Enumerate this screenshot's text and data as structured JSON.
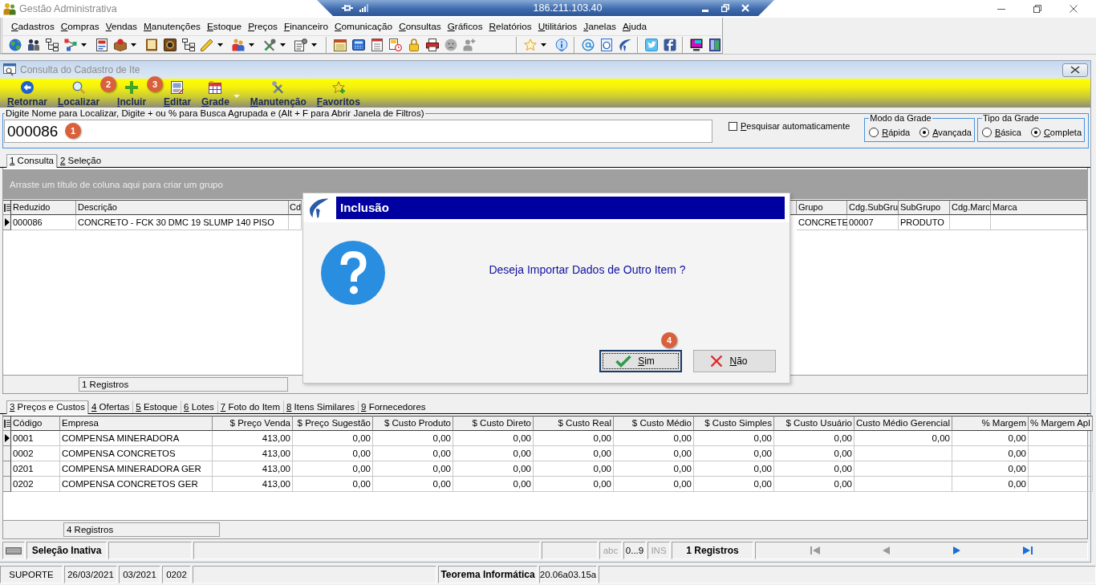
{
  "window": {
    "title": "Gestão Administrativa"
  },
  "remote_bar": {
    "address": "186.211.103.40"
  },
  "menu": [
    "Cadastros",
    "Compras",
    "Vendas",
    "Manutenções",
    "Estoque",
    "Preços",
    "Financeiro",
    "Comunicação",
    "Consultas",
    "Gráficos",
    "Relatórios",
    "Utilitários",
    "Janelas",
    "Ajuda"
  ],
  "child_window": {
    "title": "Consulta do Cadastro de Ite"
  },
  "toolbar": [
    {
      "label": "Retornar",
      "dropdown": false
    },
    {
      "label": "Localizar",
      "dropdown": false,
      "marker": "2"
    },
    {
      "label": "Incluir",
      "dropdown": false,
      "marker": "3"
    },
    {
      "label": "Editar",
      "dropdown": false
    },
    {
      "label": "Grade",
      "dropdown": true
    },
    {
      "label": "Manutenção",
      "dropdown": false
    },
    {
      "label": "Favoritos",
      "dropdown": false
    }
  ],
  "search": {
    "legend": "Digite Nome para Localizar, Digite + ou % para Busca Agrupada e (Alt + F para Abrir Janela de Filtros)",
    "value": "000086",
    "marker": "1",
    "auto_search": {
      "label": "Pesquisar automaticamente",
      "checked": false
    }
  },
  "grid_mode": {
    "title": "Modo da Grade",
    "options": [
      {
        "label": "Rápida",
        "selected": false
      },
      {
        "label": "Avançada",
        "selected": true
      }
    ]
  },
  "grid_type": {
    "title": "Tipo da Grade",
    "options": [
      {
        "label": "Básica",
        "selected": false
      },
      {
        "label": "Completa",
        "selected": true
      }
    ]
  },
  "tabs": [
    {
      "label": "1 Consulta",
      "selected": true
    },
    {
      "label": "2 Seleção",
      "selected": false
    }
  ],
  "items_table": {
    "group_hint": "Arraste um título de coluna aqui para criar um grupo",
    "columns": [
      "Reduzido",
      "Descrição",
      "Cd",
      "Grupo",
      "Cdg.SubGru",
      "SubGrupo",
      "Cdg.Marc",
      "Marca"
    ],
    "rows": [
      {
        "selected": true,
        "cells": [
          "000086",
          "CONCRETO - FCK 30 DMC 19 SLUMP 140 PISO",
          null,
          "CONCRETE",
          "00007",
          "PRODUTO",
          null,
          null
        ]
      }
    ],
    "footer": "1 Registros"
  },
  "detail_tabs": [
    {
      "label": "3 Preços e Custos",
      "selected": true
    },
    {
      "label": "4 Ofertas",
      "selected": false
    },
    {
      "label": "5 Estoque",
      "selected": false
    },
    {
      "label": "6 Lotes",
      "selected": false
    },
    {
      "label": "7 Foto do Item",
      "selected": false
    },
    {
      "label": "8 Itens Similares",
      "selected": false
    },
    {
      "label": "9 Fornecedores",
      "selected": false
    }
  ],
  "prices_table": {
    "columns": [
      {
        "label": "Código",
        "kind": "text"
      },
      {
        "label": "Empresa",
        "kind": "text"
      },
      {
        "label": "$ Preço Venda",
        "kind": "number"
      },
      {
        "label": "$ Preço Sugestão",
        "kind": "number"
      },
      {
        "label": "$ Custo Produto",
        "kind": "number"
      },
      {
        "label": "$ Custo Direto",
        "kind": "number"
      },
      {
        "label": "$ Custo Real",
        "kind": "number"
      },
      {
        "label": "$ Custo Médio",
        "kind": "number"
      },
      {
        "label": "$ Custo Simples",
        "kind": "number"
      },
      {
        "label": "$ Custo Usuário",
        "kind": "number"
      },
      {
        "label": "Custo Médio Gerencial",
        "kind": "number"
      },
      {
        "label": "% Margem",
        "kind": "number"
      },
      {
        "label": "% Margem Apl",
        "kind": "number"
      }
    ],
    "rows": [
      {
        "selected": true,
        "cells": [
          "0001",
          "COMPENSA MINERADORA",
          "413,00",
          "0,00",
          "0,00",
          "0,00",
          "0,00",
          "0,00",
          "0,00",
          "0,00",
          "0,00",
          "0,00",
          null
        ]
      },
      {
        "selected": false,
        "cells": [
          "0002",
          "COMPENSA CONCRETOS",
          "413,00",
          "0,00",
          "0,00",
          "0,00",
          "0,00",
          "0,00",
          "0,00",
          "0,00",
          null,
          "0,00",
          null
        ]
      },
      {
        "selected": false,
        "cells": [
          "0201",
          "COMPENSA MINERADORA GER",
          "413,00",
          "0,00",
          "0,00",
          "0,00",
          "0,00",
          "0,00",
          "0,00",
          "0,00",
          null,
          "0,00",
          null
        ]
      },
      {
        "selected": false,
        "cells": [
          "0202",
          "COMPENSA CONCRETOS GER",
          "413,00",
          "0,00",
          "0,00",
          "0,00",
          "0,00",
          "0,00",
          "0,00",
          "0,00",
          null,
          "0,00",
          null
        ]
      }
    ],
    "footer": "4 Registros"
  },
  "status_bar": {
    "selection": "Seleção Inativa",
    "indicators": [
      {
        "label": "abc",
        "on": false
      },
      {
        "label": "0...9",
        "on": true
      },
      {
        "label": "INS",
        "on": false
      }
    ],
    "records": "1 Registros",
    "navigation": [
      {
        "kind": "first",
        "disabled": true
      },
      {
        "kind": "previous",
        "disabled": true
      },
      {
        "kind": "next",
        "disabled": false
      },
      {
        "kind": "last",
        "disabled": false
      }
    ]
  },
  "info_bar": {
    "user": "SUPORTE",
    "date": "26/03/2021",
    "period": "03/2021",
    "branch": "0202",
    "company": "Teorema Informática",
    "version": "20.06a03.15a"
  },
  "dialog": {
    "title": "Inclusão",
    "message": "Deseja Importar Dados de Outro Item ?",
    "buttons": [
      {
        "label": "Sim",
        "kind": "confirm",
        "focused": true,
        "marker": "4"
      },
      {
        "label": "Não",
        "kind": "cancel",
        "focused": false
      }
    ]
  }
}
